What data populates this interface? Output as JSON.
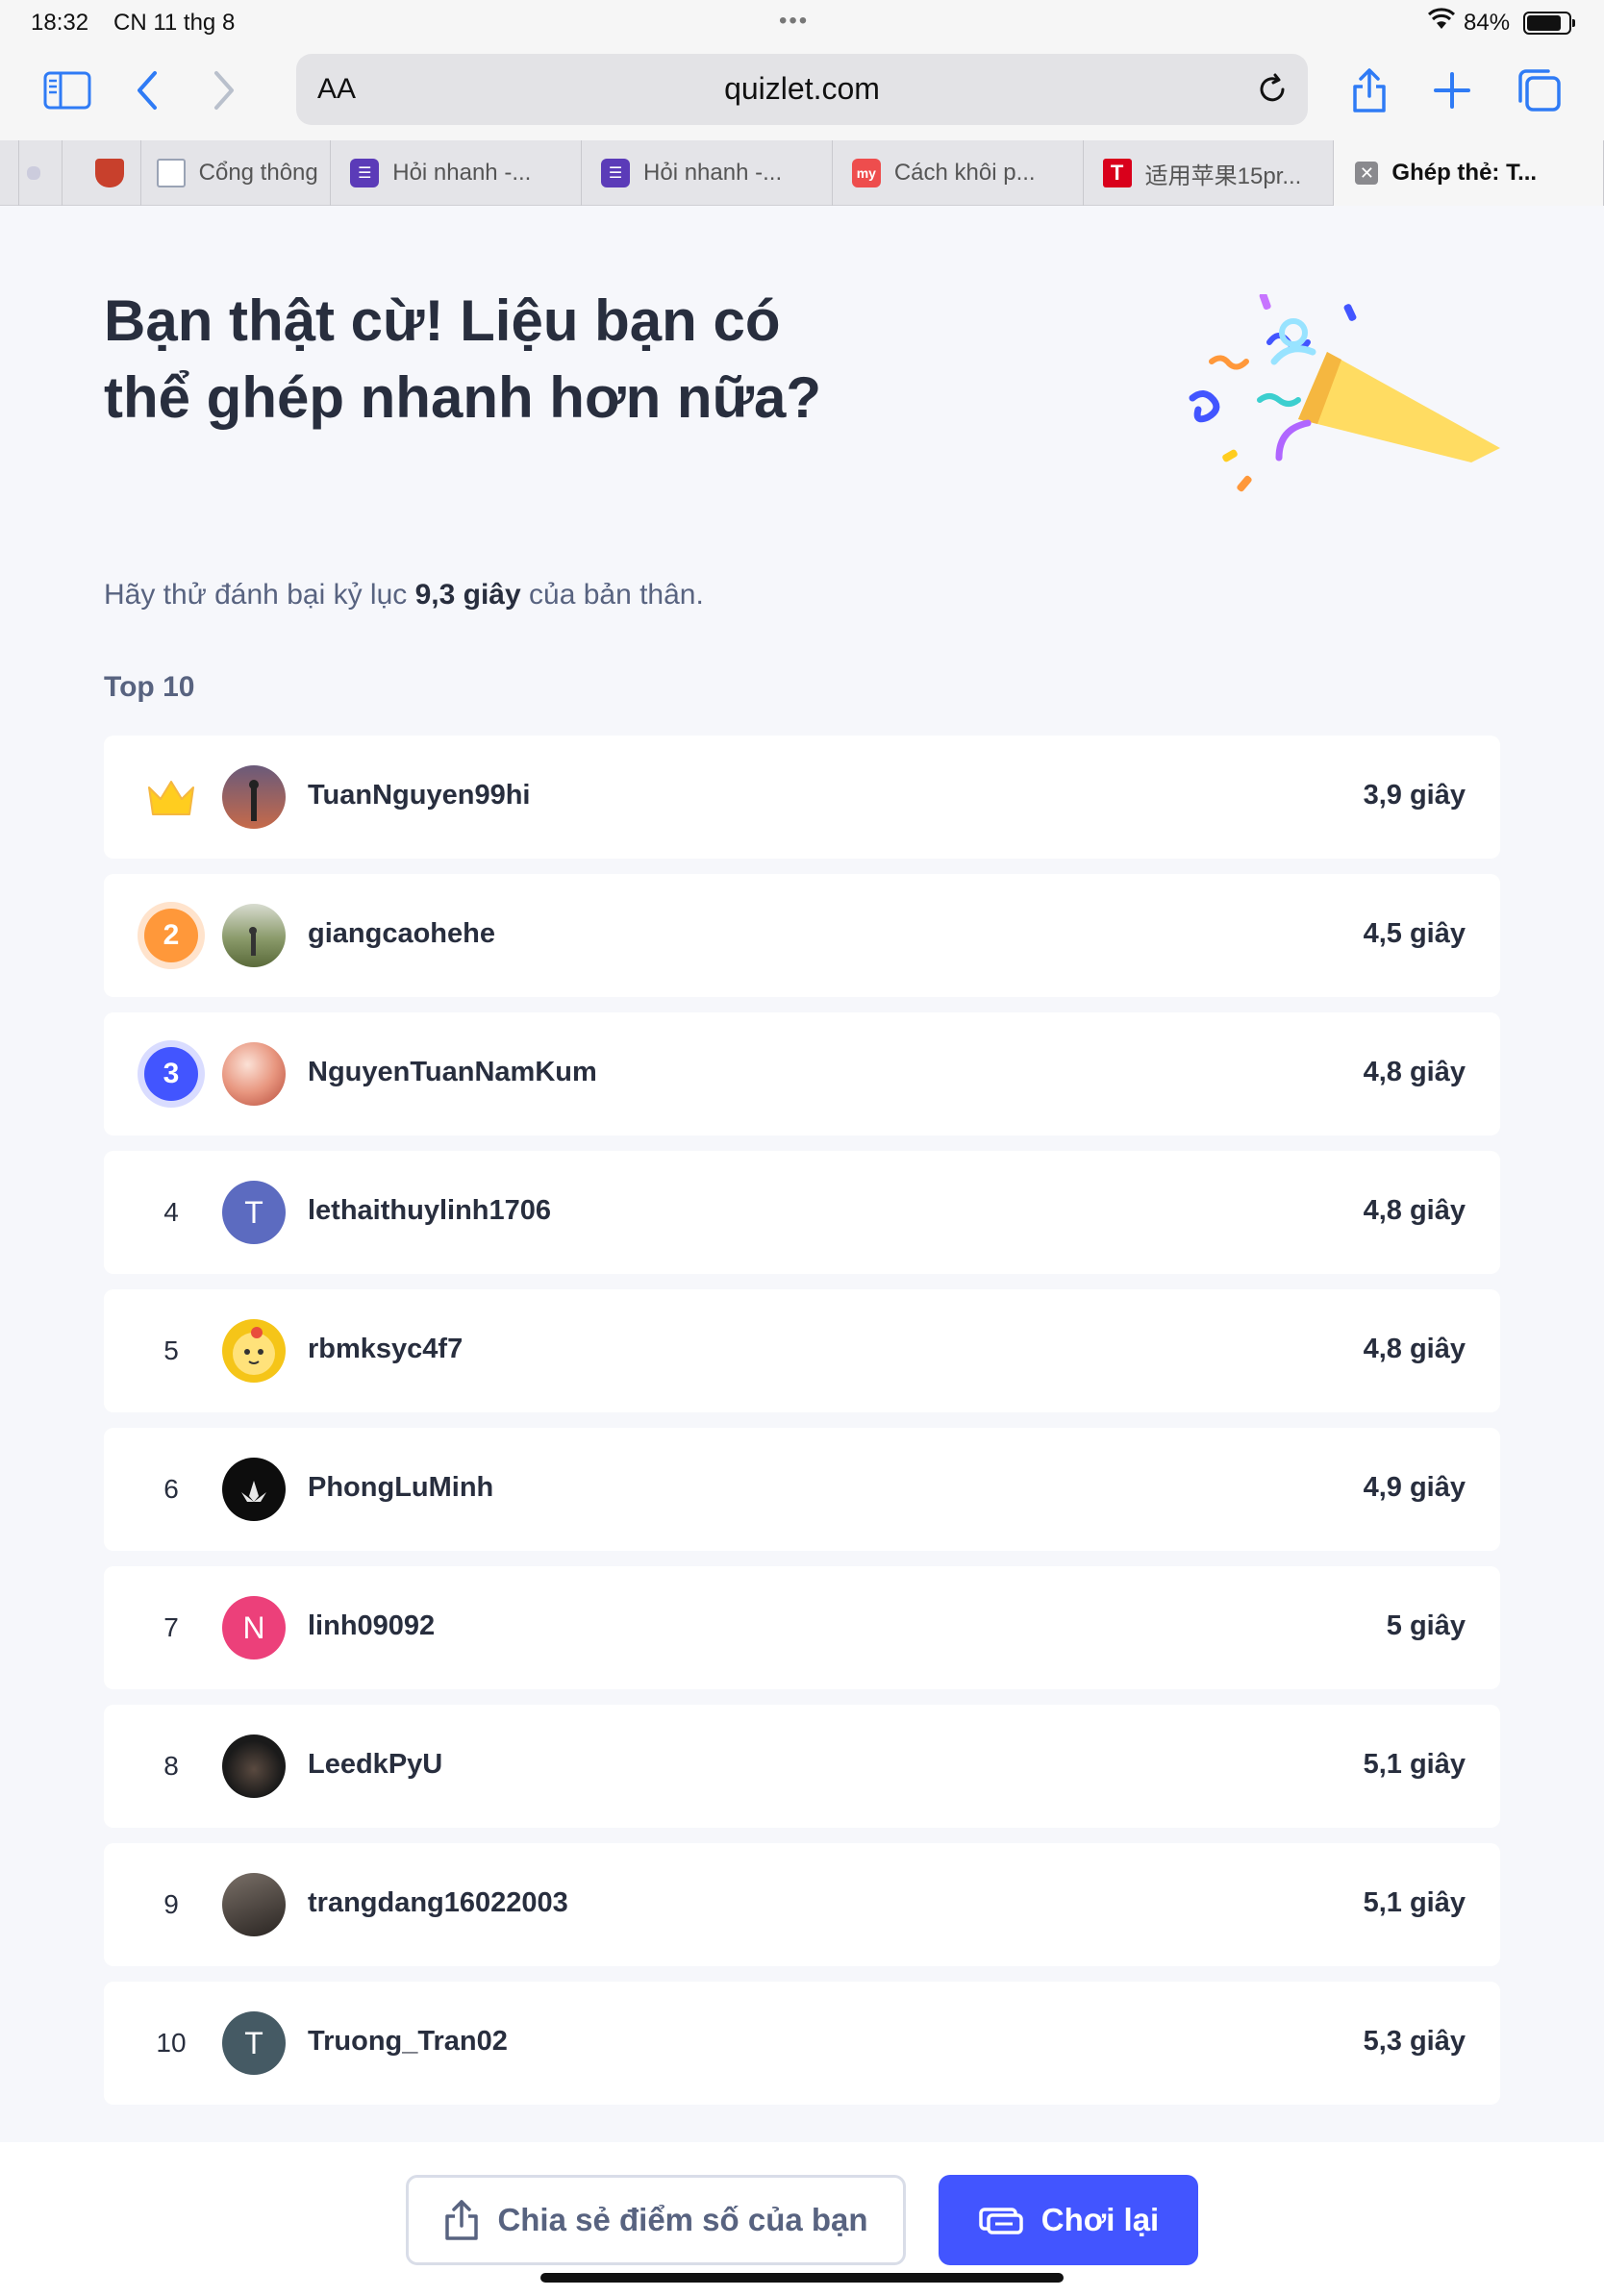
{
  "status_bar": {
    "time": "18:32",
    "date": "CN 11 thg 8",
    "battery_pct": "84%"
  },
  "toolbar": {
    "aa": "AA",
    "url": "quizlet.com"
  },
  "tabs": [
    {
      "label": "",
      "icon": "small-favicon"
    },
    {
      "label": "",
      "icon": "crest-favicon",
      "color": "#c8402c"
    },
    {
      "label": "Cổng thông",
      "icon": "document-favicon",
      "color": "#9aa3b5"
    },
    {
      "label": "Hỏi nhanh -...",
      "icon": "list-favicon",
      "color": "#5b3bb8"
    },
    {
      "label": "Hỏi nhanh -...",
      "icon": "list-favicon",
      "color": "#5b3bb8"
    },
    {
      "label": "Cách khôi p...",
      "icon": "my-favicon",
      "color": "#ee4d4d"
    },
    {
      "label": "适用苹果15pr...",
      "icon": "t-favicon",
      "color": "#d9001b"
    },
    {
      "label": "Ghép thẻ: T...",
      "icon": "close-icon",
      "active": true
    }
  ],
  "content": {
    "headline": "Bạn thật cừ! Liệu bạn có thể ghép nhanh hơn nữa?",
    "subtitle_before": "Hãy thử đánh bại kỷ lục ",
    "subtitle_record": "9,3 giây",
    "subtitle_after": " của bản thân.",
    "top_label": "Top 10"
  },
  "leaderboard": [
    {
      "rank": "1",
      "username": "TuanNguyen99hi",
      "time": "3,9 giây",
      "avatar": "photo",
      "color": "#5a4a6a"
    },
    {
      "rank": "2",
      "username": "giangcaohehe",
      "time": "4,5 giây",
      "avatar": "photo",
      "color": "#8a9a6a"
    },
    {
      "rank": "3",
      "username": "NguyenTuanNamKum",
      "time": "4,8 giây",
      "avatar": "photo",
      "color": "#d98a7a"
    },
    {
      "rank": "4",
      "username": "lethaithuylinh1706",
      "time": "4,8 giây",
      "avatar": "T",
      "color": "#5c6bc0"
    },
    {
      "rank": "5",
      "username": "rbmksyc4f7",
      "time": "4,8 giây",
      "avatar": "photo",
      "color": "#f5c518"
    },
    {
      "rank": "6",
      "username": "PhongLuMinh",
      "time": "4,9 giây",
      "avatar": "photo",
      "color": "#111111"
    },
    {
      "rank": "7",
      "username": "linh09092",
      "time": "5 giây",
      "avatar": "N",
      "color": "#ec407a"
    },
    {
      "rank": "8",
      "username": "LeedkPyU",
      "time": "5,1 giây",
      "avatar": "photo",
      "color": "#1a1a1a"
    },
    {
      "rank": "9",
      "username": "trangdang16022003",
      "time": "5,1 giây",
      "avatar": "photo",
      "color": "#3a3530"
    },
    {
      "rank": "10",
      "username": "Truong_Tran02",
      "time": "5,3 giây",
      "avatar": "T",
      "color": "#455a64"
    }
  ],
  "footer": {
    "share_label": "Chia sẻ điểm số của bạn",
    "replay_label": "Chơi lại"
  }
}
